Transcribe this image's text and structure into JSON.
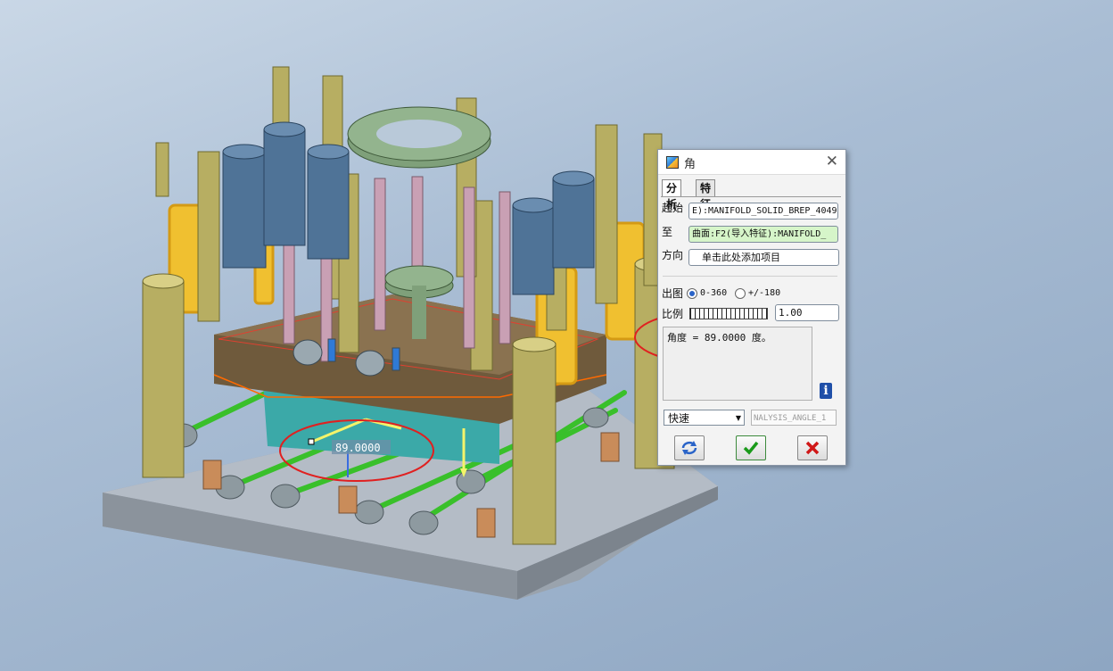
{
  "dialog": {
    "title": "角",
    "close": "✕",
    "tabs": [
      "分析",
      "特征"
    ],
    "labels": {
      "from": "起始",
      "to": "至",
      "direction": "方向",
      "plot": "出图",
      "scale": "比例"
    },
    "from_value": "E):MANIFOLD_SOLID_BREP_4049",
    "to_value": "曲面:F2(导入特征):MANIFOLD_",
    "direction_value": "单击此处添加项目",
    "radio_0_360": "0-360",
    "radio_pm180": "+/-180",
    "scale_value": "1.00",
    "result_text": "角度 = 89.0000 度。",
    "info_icon": "i",
    "mode_select": "快速",
    "name_value": "NALYSIS_ANGLE_1"
  },
  "viewport": {
    "angle_readout": "89.0000"
  }
}
